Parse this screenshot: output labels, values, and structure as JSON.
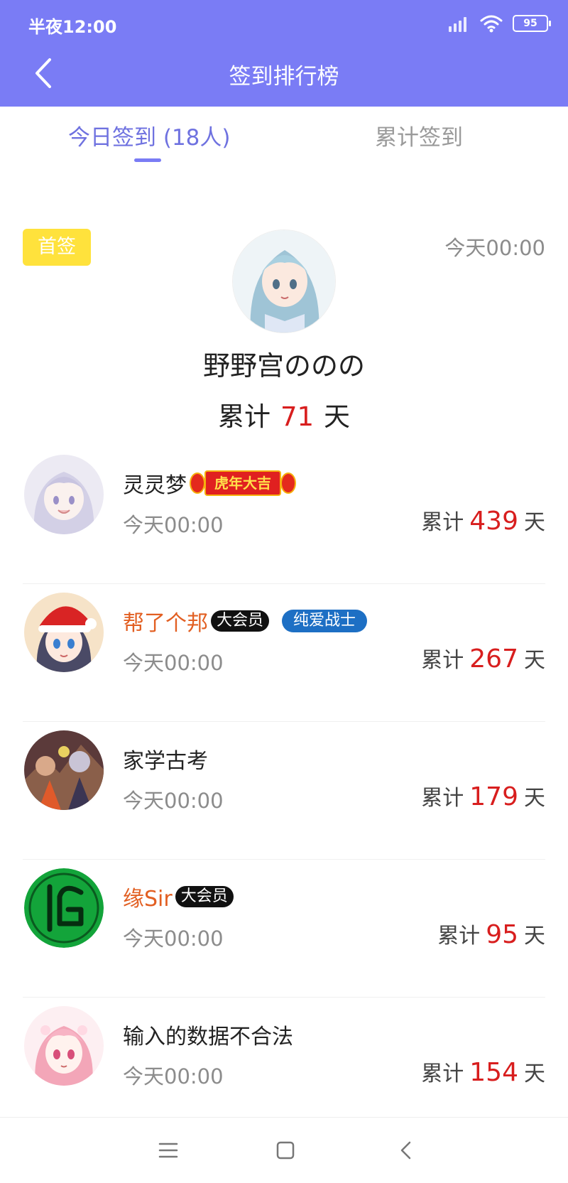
{
  "status_bar": {
    "time": "半夜12:00",
    "battery": "95"
  },
  "header": {
    "title": "签到排行榜",
    "back_icon": "chevron-left-icon"
  },
  "tabs": [
    {
      "label": "今日签到 (18人)",
      "active": true
    },
    {
      "label": "累计签到",
      "active": false
    }
  ],
  "top_signer": {
    "badge": "首签",
    "time": "今天00:00",
    "name": "野野宫ののの",
    "total_prefix": "累计",
    "total_days": "71",
    "total_suffix": "天"
  },
  "rows": [
    {
      "name": "灵灵梦",
      "badge": "虎年大吉",
      "time": "今天00:00",
      "total_prefix": "累计",
      "total_days": "439",
      "total_suffix": "天"
    },
    {
      "name": "帮了个邦",
      "tag_black": "大会员",
      "tag_blue": "纯爱战士",
      "time": "今天00:00",
      "total_prefix": "累计",
      "total_days": "267",
      "total_suffix": "天"
    },
    {
      "name": "家学古考",
      "time": "今天00:00",
      "total_prefix": "累计",
      "total_days": "179",
      "total_suffix": "天"
    },
    {
      "name": "缘Sir",
      "tag_black": "大会员",
      "time": "今天00:00",
      "total_prefix": "累计",
      "total_days": "95",
      "total_suffix": "天"
    },
    {
      "name": "输入的数据不合法",
      "time": "今天00:00",
      "total_prefix": "累计",
      "total_days": "154",
      "total_suffix": "天"
    }
  ],
  "colors": {
    "header": "#7a7cf5",
    "accent_red": "#d81e1e",
    "vip_orange": "#e25f22",
    "first_badge": "#ffe23c"
  },
  "nav_bar": {
    "icons": [
      "menu-icon",
      "home-square-icon",
      "back-chevron-icon"
    ]
  }
}
